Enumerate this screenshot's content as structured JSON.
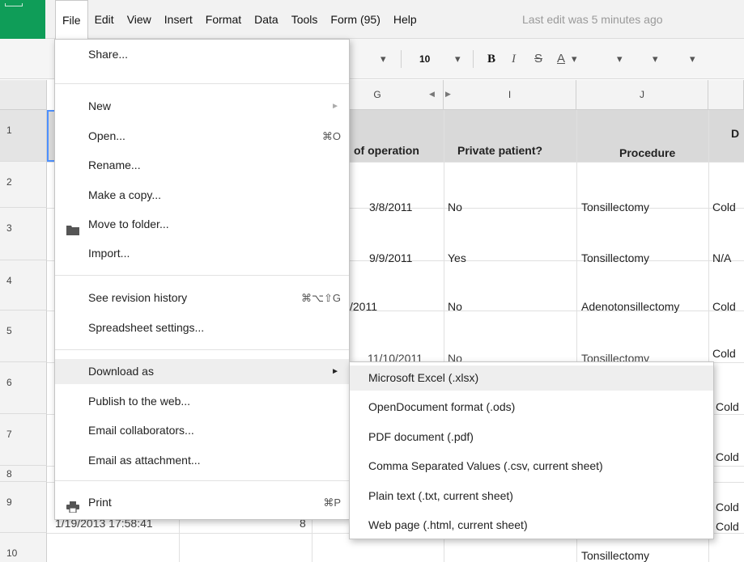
{
  "menubar": {
    "items": [
      "File",
      "Edit",
      "View",
      "Insert",
      "Format",
      "Data",
      "Tools",
      "Form (95)",
      "Help"
    ],
    "last_edit": "Last edit was 5 minutes ago"
  },
  "toolbar": {
    "font_size": "10",
    "bold": "B",
    "italic": "I",
    "strike": "S",
    "text_color": "A",
    "chevron": "▾"
  },
  "columns": {
    "g": "G",
    "i": "I",
    "j": "J"
  },
  "rows": [
    "1",
    "2",
    "3",
    "4",
    "5",
    "6",
    "7",
    "8",
    "9",
    "10"
  ],
  "sheet": {
    "header": {
      "date_of_operation": "of operation",
      "private_patient": "Private patient?",
      "procedure": "Procedure",
      "next_col": "D"
    },
    "cells": [
      {
        "date": "3/8/2011",
        "private": "No",
        "procedure": "Tonsillectomy",
        "next": "Cold"
      },
      {
        "date": "9/9/2011",
        "private": "Yes",
        "procedure": "Tonsillectomy",
        "next": "N/A"
      },
      {
        "date": "/2011",
        "private": "No",
        "procedure": "Adenotonsillectomy",
        "next": "Cold"
      },
      {
        "date": "11/10/2011",
        "private": "No",
        "procedure": "Tonsillectomy",
        "next": "Cold"
      },
      {
        "next": "Cold"
      },
      {
        "next": "Cold"
      },
      {
        "next": "Cold"
      },
      {
        "next": "Cold"
      }
    ],
    "row9_timestamp": "1/19/2013 17:58:41",
    "row9_number": "8",
    "row10_procedure": "Tonsillectomy"
  },
  "file_menu": {
    "share": "Share...",
    "new": "New",
    "open": "Open...",
    "open_shortcut": "⌘O",
    "rename": "Rename...",
    "make_copy": "Make a copy...",
    "move_to_folder": "Move to folder...",
    "import": "Import...",
    "revision_history": "See revision history",
    "revision_shortcut": "⌘⌥⇧G",
    "spreadsheet_settings": "Spreadsheet settings...",
    "download_as": "Download as",
    "publish": "Publish to the web...",
    "email_collaborators": "Email collaborators...",
    "email_attachment": "Email as attachment...",
    "print": "Print",
    "print_shortcut": "⌘P",
    "submenu_arrow": "►"
  },
  "download_submenu": [
    "Microsoft Excel (.xlsx)",
    "OpenDocument format (.ods)",
    "PDF document (.pdf)",
    "Comma Separated Values (.csv, current sheet)",
    "Plain text (.txt, current sheet)",
    "Web page (.html, current sheet)"
  ],
  "colors": {
    "logo_green": "#0f9d58",
    "menu_highlight": "#eeeeee",
    "header_row_bg": "#d9d9d9"
  }
}
